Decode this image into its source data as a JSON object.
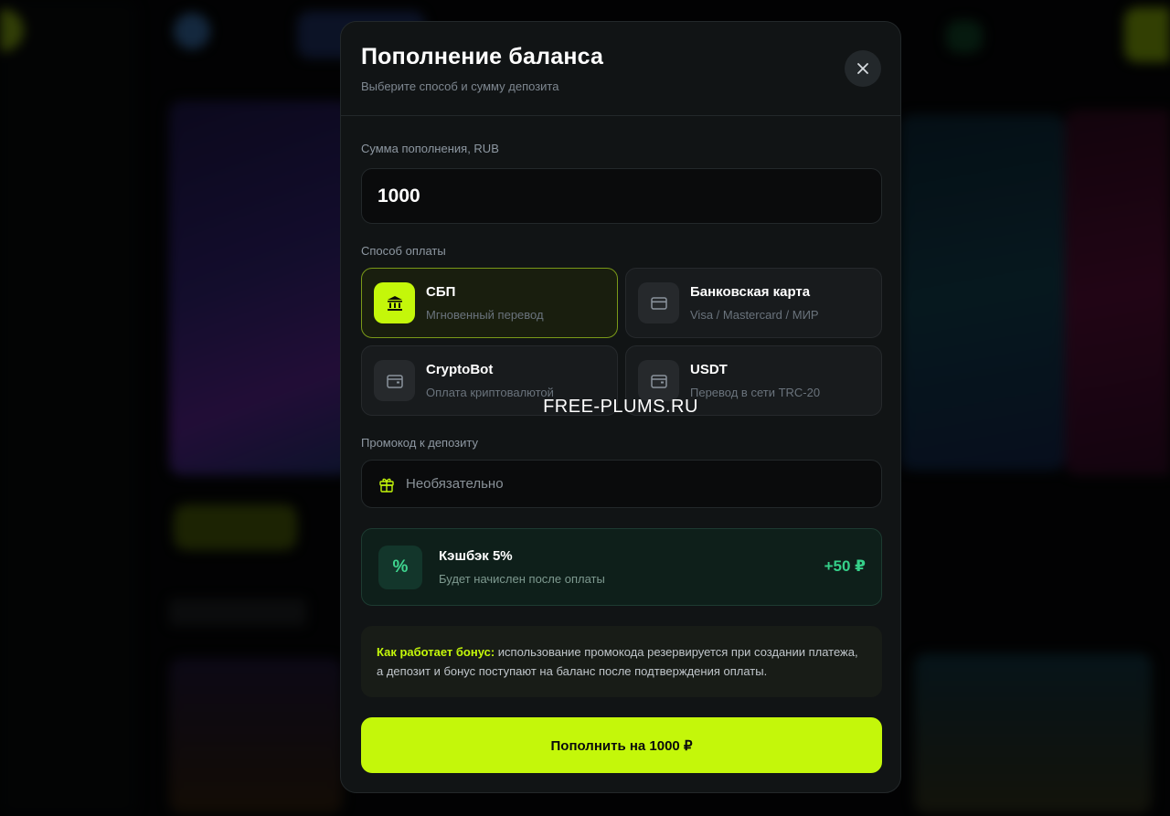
{
  "modal": {
    "title": "Пополнение баланса",
    "subtitle": "Выберите способ и сумму депозита"
  },
  "amount": {
    "label": "Сумма пополнения, RUB",
    "value": "1000"
  },
  "payment": {
    "label": "Способ оплаты",
    "methods": [
      {
        "name": "СБП",
        "desc": "Мгновенный перевод",
        "icon": "bank-icon",
        "selected": true
      },
      {
        "name": "Банковская карта",
        "desc": "Visa / Mastercard / МИР",
        "icon": "card-icon",
        "selected": false
      },
      {
        "name": "CryptoBot",
        "desc": "Оплата криптовалютой",
        "icon": "wallet-icon",
        "selected": false
      },
      {
        "name": "USDT",
        "desc": "Перевод в сети TRC-20",
        "icon": "wallet-icon",
        "selected": false
      }
    ]
  },
  "watermark": "FREE-PLUMS.RU",
  "promo": {
    "label": "Промокод к депозиту",
    "placeholder": "Необязательно",
    "icon": "gift-icon"
  },
  "cashback": {
    "icon_text": "%",
    "title": "Кэшбэк 5%",
    "desc": "Будет начислен после оплаты",
    "amount": "+50 ₽"
  },
  "info": {
    "accent": "Как работает бонус:",
    "text": " использование промокода резервируется при создании платежа, а депозит и бонус поступают на баланс после подтверждения оплаты."
  },
  "submit_label": "Пополнить на 1000 ₽",
  "colors": {
    "accent": "#c4f70a",
    "cashback": "#35d089",
    "modal_bg": "#111415"
  }
}
